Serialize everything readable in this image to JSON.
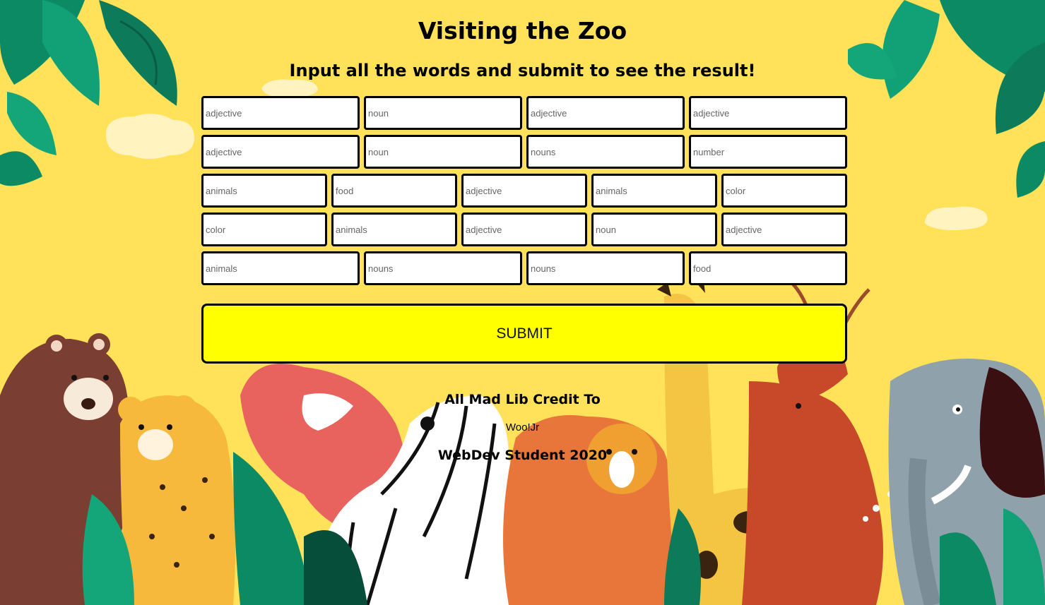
{
  "page": {
    "title": "Visiting the Zoo",
    "subtitle": "Input all the words and submit to see the result!"
  },
  "form": {
    "rows": [
      [
        "adjective",
        "noun",
        "adjective",
        "adjective"
      ],
      [
        "adjective",
        "noun",
        "nouns",
        "number"
      ],
      [
        "animals",
        "food",
        "adjective",
        "animals",
        "color"
      ],
      [
        "color",
        "animals",
        "adjective",
        "noun",
        "adjective"
      ],
      [
        "animals",
        "nouns",
        "nouns",
        "food"
      ]
    ],
    "submit_label": "SUBMIT"
  },
  "footer": {
    "credit_heading": "All Mad Lib Credit To",
    "credit_source": "Woo!Jr",
    "author": "WebDev Student 2020"
  },
  "colors": {
    "background": "#ffe15a",
    "submit_button": "#ffff00",
    "input_border": "#000000"
  },
  "background_art": {
    "description_icons": [
      "leaf-icon",
      "bear-icon",
      "cheetah-icon",
      "zebra-icon",
      "lion-icon",
      "giraffe-icon",
      "deer-icon",
      "elephant-icon",
      "flamingo-icon",
      "cloud-icon"
    ]
  }
}
